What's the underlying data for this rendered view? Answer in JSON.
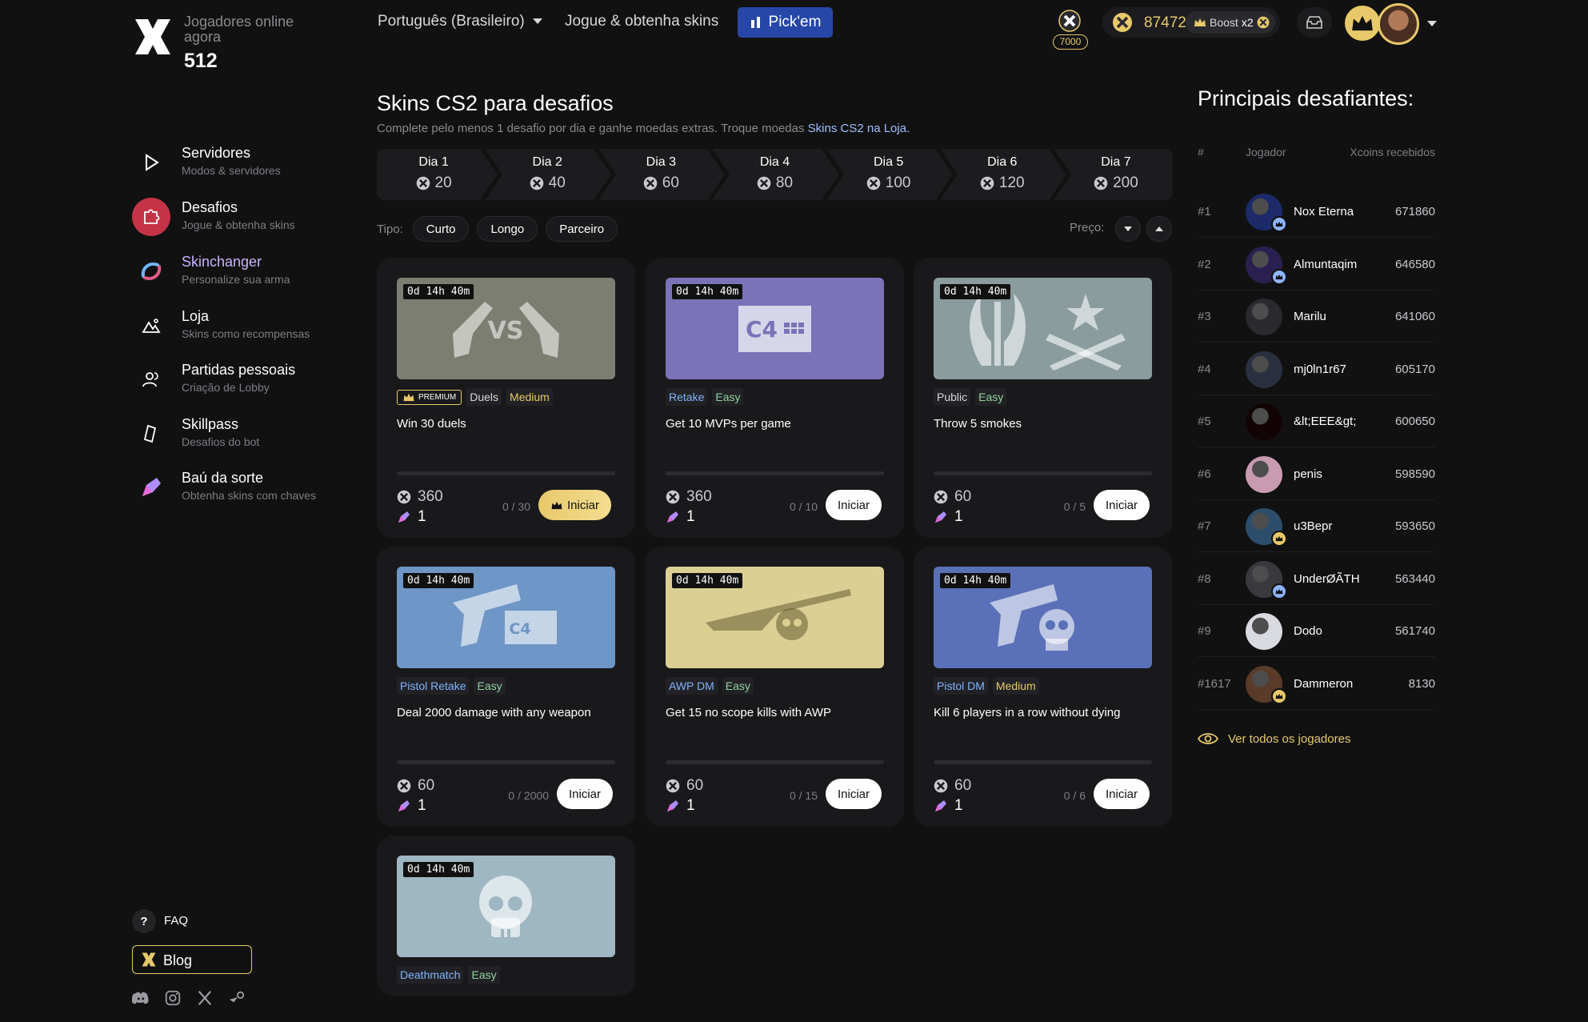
{
  "header": {
    "online_label": "Jogadores online agora",
    "online_count": "512",
    "language": "Português (Brasileiro)",
    "play_link": "Jogue & obtenha skins",
    "pickem_label": "Pick'em",
    "xp_badge_value": "7000",
    "coins": "87472",
    "boost_label": "Boost",
    "boost_multiplier": "x2"
  },
  "sidebar": {
    "items": [
      {
        "title": "Servidores",
        "subtitle": "Modos & servidores",
        "icon": "play-icon"
      },
      {
        "title": "Desafios",
        "subtitle": "Jogue & obtenha skins",
        "icon": "puzzle-icon"
      },
      {
        "title": "Skinchanger",
        "subtitle": "Personalize sua arma",
        "icon": "swirl-icon"
      },
      {
        "title": "Loja",
        "subtitle": "Skins como recompensas",
        "icon": "mountain-icon"
      },
      {
        "title": "Partidas pessoais",
        "subtitle": "Criação de Lobby",
        "icon": "users-icon"
      },
      {
        "title": "Skillpass",
        "subtitle": "Desafios do bot",
        "icon": "ticket-icon"
      },
      {
        "title": "Baú da sorte",
        "subtitle": "Obtenha skins com chaves",
        "icon": "key-icon"
      }
    ],
    "faq_label": "FAQ",
    "blog_label": "Blog"
  },
  "main": {
    "title": "Skins CS2 para desafios",
    "subtitle_prefix": "Complete pelo menos 1 desafio por dia e ganhe moedas extras. Troque moedas ",
    "subtitle_link": "Skins CS2 na Loja.",
    "days": [
      {
        "label": "Dia 1",
        "value": "20"
      },
      {
        "label": "Dia 2",
        "value": "40"
      },
      {
        "label": "Dia 3",
        "value": "60"
      },
      {
        "label": "Dia 4",
        "value": "80"
      },
      {
        "label": "Dia 5",
        "value": "100"
      },
      {
        "label": "Dia 6",
        "value": "120"
      },
      {
        "label": "Dia 7",
        "value": "200"
      }
    ],
    "filter_label": "Tipo:",
    "filters": [
      "Curto",
      "Longo",
      "Parceiro"
    ],
    "price_label": "Preço:",
    "premium_label": "PREMIUM",
    "start_label": "Iniciar",
    "cards": [
      {
        "timer": "0d  14h  40m",
        "premium": true,
        "mode": "Duels",
        "difficulty": "Medium",
        "title": "Win 30 duels",
        "reward": "360",
        "keys": "1",
        "progress": "0 / 30",
        "image": "duel-pistols",
        "bg": "#7c7e72"
      },
      {
        "timer": "0d  14h  40m",
        "premium": false,
        "mode": "Retake",
        "difficulty": "Easy",
        "title": "Get 10 MVPs per game",
        "reward": "360",
        "keys": "1",
        "progress": "0 / 10",
        "image": "c4-bomb",
        "bg": "#7b73b8"
      },
      {
        "timer": "0d  14h  40m",
        "premium": false,
        "mode": "Public",
        "difficulty": "Easy",
        "title": "Throw 5 smokes",
        "reward": "60",
        "keys": "1",
        "progress": "0 / 5",
        "image": "ct-t-emblems",
        "bg": "#8a9c9d"
      },
      {
        "timer": "0d  14h  40m",
        "premium": false,
        "mode": "Pistol Retake",
        "difficulty": "Easy",
        "title": "Deal 2000 damage with any weapon",
        "reward": "60",
        "keys": "1",
        "progress": "0 / 2000",
        "image": "pistol-c4",
        "bg": "#6e96c6"
      },
      {
        "timer": "0d  14h  40m",
        "premium": false,
        "mode": "AWP DM",
        "difficulty": "Easy",
        "title": "Get 15 no scope kills with AWP",
        "reward": "60",
        "keys": "1",
        "progress": "0 / 15",
        "image": "awp-skull",
        "bg": "#dccf94"
      },
      {
        "timer": "0d  14h  40m",
        "premium": false,
        "mode": "Pistol DM",
        "difficulty": "Medium",
        "title": "Kill 6 players in a row without dying",
        "reward": "60",
        "keys": "1",
        "progress": "0 / 6",
        "image": "pistol-skull",
        "bg": "#5a70b8"
      },
      {
        "timer": "0d  14h  40m",
        "premium": false,
        "mode": "Deathmatch",
        "difficulty": "Easy",
        "title": "",
        "reward": "",
        "keys": "",
        "progress": "",
        "image": "skull",
        "bg": "#9fb7c2"
      }
    ]
  },
  "leaderboard": {
    "title": "Principais desafiantes:",
    "col_rank": "#",
    "col_player": "Jogador",
    "col_score": "Xcoins recebidos",
    "rows": [
      {
        "rank": "#1",
        "name": "Nox Eterna",
        "score": "671860",
        "avatar_color": "#1c2a6a",
        "badge": true
      },
      {
        "rank": "#2",
        "name": "Almuntaqim",
        "score": "646580",
        "avatar_color": "#2a2050",
        "badge": true
      },
      {
        "rank": "#3",
        "name": "Marilu",
        "score": "641060",
        "avatar_color": "#2a2a2e",
        "badge": false
      },
      {
        "rank": "#4",
        "name": "mj0ln1r67",
        "score": "605170",
        "avatar_color": "#2a3040",
        "badge": false
      },
      {
        "rank": "#5",
        "name": "&lt;EEE&gt;",
        "score": "600650",
        "avatar_color": "#120404",
        "badge": false
      },
      {
        "rank": "#6",
        "name": "penis",
        "score": "598590",
        "avatar_color": "#c99bb0",
        "badge": false
      },
      {
        "rank": "#7",
        "name": "u3Bepr",
        "score": "593650",
        "avatar_color": "#2c4e6a",
        "badge": true
      },
      {
        "rank": "#8",
        "name": "UnderØÃTH",
        "score": "563440",
        "avatar_color": "#3a3a3e",
        "badge": true
      },
      {
        "rank": "#9",
        "name": "Dodo",
        "score": "561740",
        "avatar_color": "#d9d9e0",
        "badge": false
      },
      {
        "rank": "#1617",
        "name": "Dammeron",
        "score": "8130",
        "avatar_color": "#5a3a28",
        "badge": true
      }
    ],
    "see_all": "Ver todos os jogadores"
  },
  "colors": {
    "gold": "#e8c96a",
    "active_nav": "#c73346",
    "pickem_blue": "#2647a8",
    "mode_tag_blue": "#7fb4ff",
    "easy_green": "#8fd19e",
    "medium_yellow": "#e8c96a"
  }
}
